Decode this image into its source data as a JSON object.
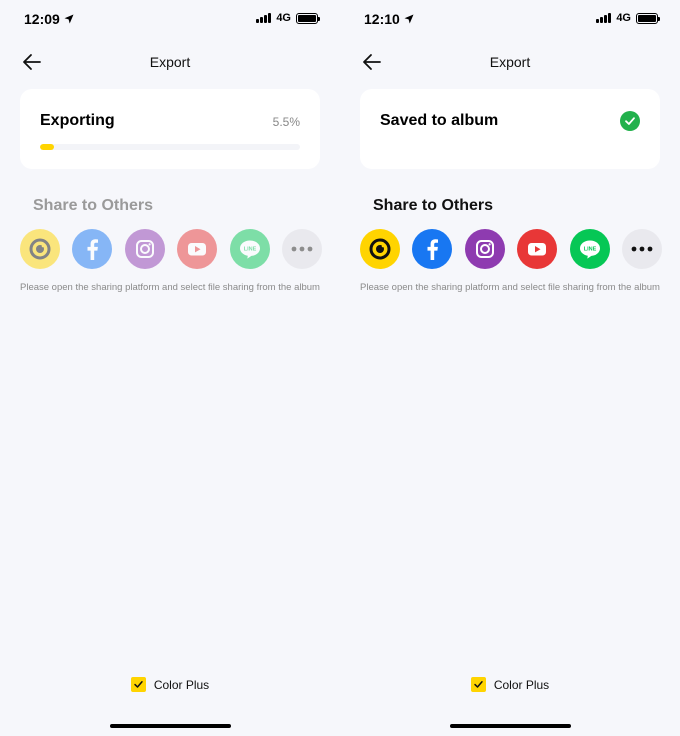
{
  "screens": [
    {
      "status": {
        "time": "12:09",
        "network": "4G"
      },
      "nav": {
        "title": "Export"
      },
      "card": {
        "title": "Exporting",
        "percent_text": "5.5%",
        "progress": 0.055
      },
      "share": {
        "title": "Share to Others",
        "targets": [
          {
            "name": "camera-app",
            "color": "#ffd400"
          },
          {
            "name": "facebook",
            "color": "#1877f2"
          },
          {
            "name": "instagram",
            "color": "#8e3bb0"
          },
          {
            "name": "youtube",
            "color": "#e83737"
          },
          {
            "name": "line",
            "color": "#06c755",
            "label": "LINE"
          },
          {
            "name": "more",
            "color": "#e9e9ee"
          }
        ],
        "hint": "Please open the sharing platform and select file sharing from the album"
      },
      "footer": {
        "label": "Color Plus",
        "checked": true
      }
    },
    {
      "status": {
        "time": "12:10",
        "network": "4G"
      },
      "nav": {
        "title": "Export"
      },
      "card": {
        "title": "Saved to album"
      },
      "share": {
        "title": "Share to Others",
        "targets": [
          {
            "name": "camera-app",
            "color": "#ffd400"
          },
          {
            "name": "facebook",
            "color": "#1877f2"
          },
          {
            "name": "instagram",
            "color": "#8e3bb0"
          },
          {
            "name": "youtube",
            "color": "#e83737"
          },
          {
            "name": "line",
            "color": "#06c755",
            "label": "LINE"
          },
          {
            "name": "more",
            "color": "#e9e9ee"
          }
        ],
        "hint": "Please open the sharing platform and select file sharing from the album"
      },
      "footer": {
        "label": "Color Plus",
        "checked": true
      }
    }
  ]
}
